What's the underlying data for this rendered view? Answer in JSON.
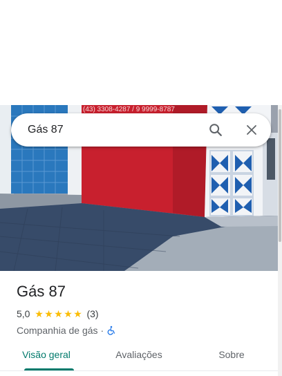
{
  "search": {
    "query": "Gás 87",
    "search_icon": "search-icon",
    "close_icon": "close-icon"
  },
  "photo": {
    "storefront_sign_text": "(43) 3308-4287 / 9 9999-8787",
    "colors": {
      "wall_red": "#c8202e",
      "tile_blue": "#1f6fb5",
      "pavement": "#364a66",
      "sky_shadow": "#2b3a52"
    }
  },
  "place": {
    "title": "Gás 87",
    "rating": "5,0",
    "stars": 5,
    "review_count": "(3)",
    "category": "Companhia de gás",
    "separator": "·",
    "accessibility_icon": "wheelchair-icon"
  },
  "tabs": [
    {
      "label": "Visão geral",
      "active": true
    },
    {
      "label": "Avaliações",
      "active": false
    },
    {
      "label": "Sobre",
      "active": false
    }
  ],
  "colors": {
    "accent": "#00796b",
    "star": "#fbbc04",
    "text_primary": "#202124",
    "text_secondary": "#5f6368",
    "accessibility_blue": "#1a73e8"
  }
}
